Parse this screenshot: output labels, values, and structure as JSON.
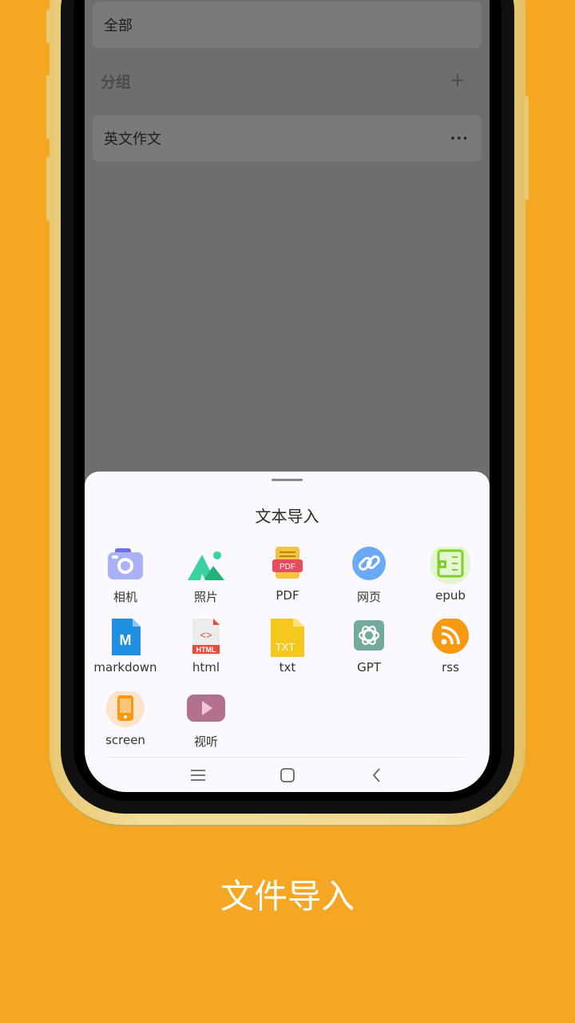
{
  "list": {
    "all_label": "全部",
    "group_label": "分组",
    "group_item": "英文作文"
  },
  "sheet": {
    "title": "文本导入",
    "items": [
      {
        "label": "相机",
        "icon": "camera-icon"
      },
      {
        "label": "照片",
        "icon": "photo-icon"
      },
      {
        "label": "PDF",
        "icon": "pdf-icon"
      },
      {
        "label": "网页",
        "icon": "link-icon"
      },
      {
        "label": "epub",
        "icon": "epub-icon"
      },
      {
        "label": "markdown",
        "icon": "markdown-icon"
      },
      {
        "label": "html",
        "icon": "html-icon"
      },
      {
        "label": "txt",
        "icon": "txt-icon"
      },
      {
        "label": "GPT",
        "icon": "gpt-icon"
      },
      {
        "label": "rss",
        "icon": "rss-icon"
      },
      {
        "label": "screen",
        "icon": "screen-icon"
      },
      {
        "label": "视听",
        "icon": "video-icon"
      }
    ]
  },
  "caption": "文件导入",
  "colors": {
    "background": "#F5A623",
    "phone_frame": "#F1D98F"
  }
}
